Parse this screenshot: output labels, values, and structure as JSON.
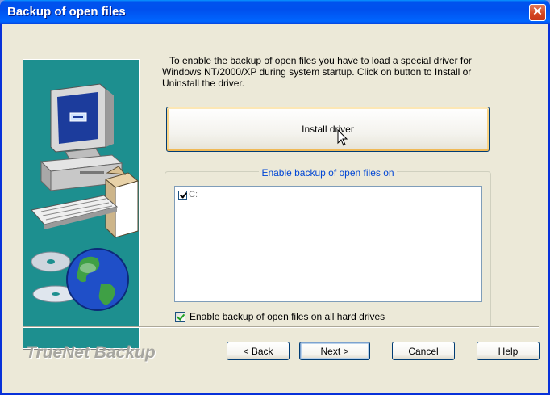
{
  "window": {
    "title": "Backup of open files",
    "close_glyph": "✕"
  },
  "intro_text": "To enable the backup of open files you have to load a special driver for Windows NT/2000/XP during system startup. Click on button to Install or Uninstall the driver.",
  "install_button_label": "Install driver",
  "group": {
    "legend": "Enable backup of open files on",
    "drives": [
      {
        "label": "C:",
        "checked": true
      }
    ],
    "all_drives_label": "Enable backup of open files on all hard drives",
    "all_drives_checked": true
  },
  "brand": "TrueNet Backup",
  "buttons": {
    "back": "< Back",
    "next": "Next >",
    "cancel": "Cancel",
    "help": "Help"
  },
  "colors": {
    "title_bar": "#0053ee",
    "illustration_bg": "#1d8f8f",
    "legend_text": "#0046d5"
  },
  "icons": [
    "computer-illustration",
    "globe-cd-illustration",
    "mouse-cursor"
  ]
}
